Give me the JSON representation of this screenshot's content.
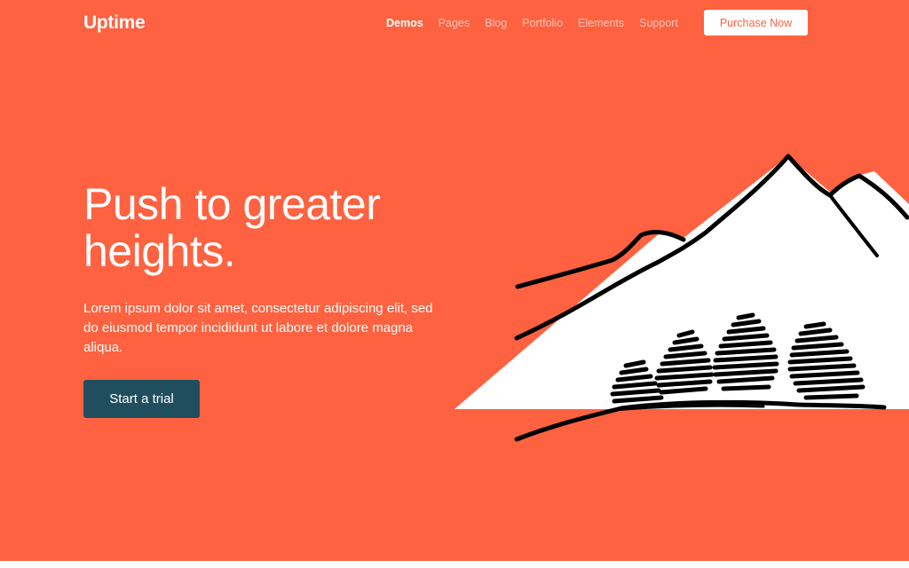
{
  "brand": {
    "logo_text": "Uptime"
  },
  "nav": {
    "items": [
      {
        "label": "Demos",
        "active": true
      },
      {
        "label": "Pages",
        "active": false
      },
      {
        "label": "Blog",
        "active": false
      },
      {
        "label": "Portfolio",
        "active": false
      },
      {
        "label": "Elements",
        "active": false
      },
      {
        "label": "Support",
        "active": false
      }
    ],
    "cta_label": "Purchase Now"
  },
  "hero": {
    "title": "Push to greater heights.",
    "description": "Lorem ipsum dolor sit amet, consectetur adipiscing elit, sed do eiusmod tempor incididunt ut labore et dolore magna aliqua.",
    "button_label": "Start a trial",
    "illustration": "mountains-trees-illustration"
  },
  "colors": {
    "background": "#ff6240",
    "text": "#ffffff",
    "button_dark": "#1f4f5f",
    "cta_text": "#ff6240"
  }
}
